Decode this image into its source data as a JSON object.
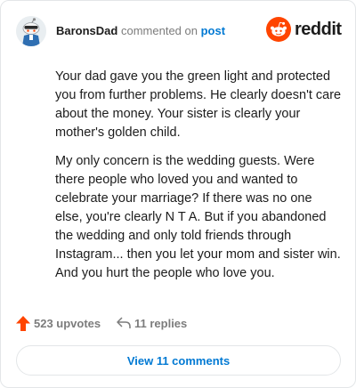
{
  "comment": {
    "username": "BaronsDad",
    "action_text": "commented on",
    "post_link": "post",
    "paragraphs": [
      "Your dad gave you the green light and protected you from further problems. He clearly doesn't care about the money. Your sister is clearly your mother's golden child.",
      "My only concern is the wedding guests. Were there people who loved you and wanted to celebrate your marriage? If there was no one else, you're clearly N T A. But if you abandoned the wedding and only told friends through Instagram... then you let your mom and sister win. And you hurt the people who love you."
    ]
  },
  "brand": {
    "logo_text": "reddit",
    "color": "#ff4500"
  },
  "actions": {
    "upvotes": "523 upvotes",
    "replies": "11 replies"
  },
  "footer": {
    "view_comments": "View 11 comments"
  },
  "colors": {
    "link": "#0079d3",
    "upvote": "#ff4500",
    "text": "#1c1c1c",
    "muted": "#7c7c7c"
  }
}
